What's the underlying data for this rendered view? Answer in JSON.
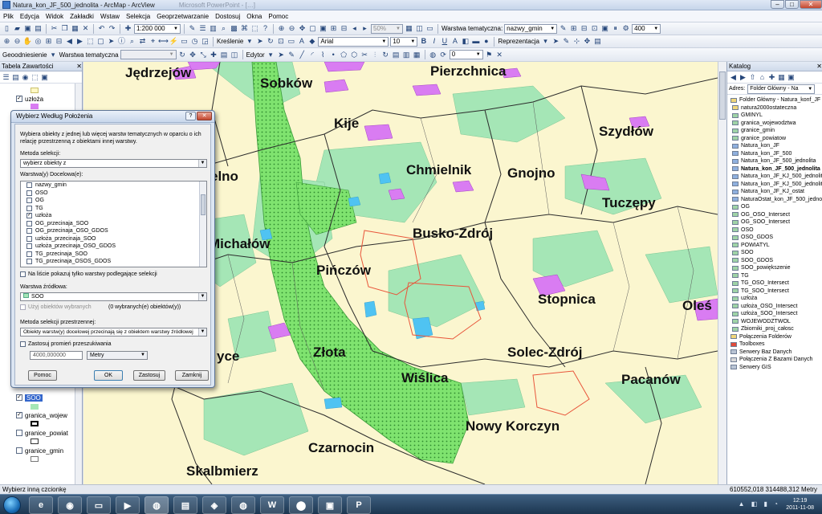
{
  "window": {
    "title": "Natura_kon_JF_500_jednolita - ArcMap - ArcView",
    "ghost_title": "Microsoft PowerPoint - […]"
  },
  "menu": [
    "Plik",
    "Edycja",
    "Widok",
    "Zakładki",
    "Wstaw",
    "Selekcja",
    "Geoprzetwarzanie",
    "Dostosuj",
    "Okna",
    "Pomoc"
  ],
  "toolbar": {
    "scale": "1:200 000",
    "zoom_percent": "50%",
    "thematic_layer_label": "Warstwa tematyczna:",
    "thematic_layer_value": "nazwy_gmin",
    "scale_value2": "400",
    "drawing_label": "Kreślenie",
    "font_name": "Arial",
    "font_size": "10",
    "representation_label": "Reprezentacja",
    "georef_label": "Geoodniesienie",
    "georef_layer_label": "Warstwa tematyczna",
    "editor_label": "Edytor",
    "angle_value": "0"
  },
  "toc": {
    "title": "Tabela Zawartości",
    "items": [
      {
        "label": "uzłoża",
        "checked": true
      },
      {
        "label": "SOO",
        "checked": true
      },
      {
        "label": "granica_wojew",
        "checked": true
      },
      {
        "label": "granice_powiat",
        "checked": false
      },
      {
        "label": "granice_gmin",
        "checked": false
      }
    ]
  },
  "map": {
    "towns": [
      "Jędrzejów",
      "Sobków",
      "Pierzchnica",
      "Kije",
      "Szydłów",
      "Chmielnik",
      "Gnojno",
      "Tuczępy",
      "elno",
      "Busko-Zdrój",
      "Michałów",
      "Pińczów",
      "Stopnica",
      "Oleś",
      "Złota",
      "Solec-Zdrój",
      "yce",
      "Wiślica",
      "Pacanów",
      "Nowy Korczyn",
      "Czarnocin",
      "Skalbmierz"
    ],
    "colors": {
      "background": "#fbf6cf",
      "forest": "#a5e6b6",
      "natura": "#7fe36f",
      "deposits": "#d97cf2",
      "water": "#4fc3f2",
      "outline": "#e8553a"
    }
  },
  "catalog": {
    "title": "Katalog",
    "address_label": "Adres:",
    "address_value": "Folder Główny - Na",
    "items": [
      {
        "label": "Folder Główny - Natura_konf_JF",
        "icon": "folder-icon",
        "bold": false
      },
      {
        "label": "natura2000ostateczna",
        "icon": "folder-icon",
        "bold": false
      },
      {
        "label": "GMINYL",
        "icon": "layer-icon",
        "bold": false
      },
      {
        "label": "granica_wojewodztwa",
        "icon": "layer-icon",
        "bold": false
      },
      {
        "label": "granice_gmin",
        "icon": "layer-icon",
        "bold": false
      },
      {
        "label": "granice_powiatow",
        "icon": "layer-icon",
        "bold": false
      },
      {
        "label": "Natura_kon_JF",
        "icon": "map-doc-icon",
        "bold": false
      },
      {
        "label": "Natura_kon_JF_500",
        "icon": "map-doc-icon",
        "bold": false
      },
      {
        "label": "Natura_kon_JF_500_jednolita",
        "icon": "map-doc-icon",
        "bold": false
      },
      {
        "label": "Natura_kon_JF_500_jednolita",
        "icon": "map-doc-icon",
        "bold": true
      },
      {
        "label": "Natura_kon_JF_KJ_500_jednolita",
        "icon": "map-doc-icon",
        "bold": false
      },
      {
        "label": "Natura_kon_JF_KJ_500_jednolita",
        "icon": "map-doc-icon",
        "bold": false
      },
      {
        "label": "Natura_kon_JF_KJ_ostat",
        "icon": "map-doc-icon",
        "bold": false
      },
      {
        "label": "NaturaOstat_kon_JF_500_jednolita",
        "icon": "map-doc-icon",
        "bold": false
      },
      {
        "label": "OG",
        "icon": "layer-icon",
        "bold": false
      },
      {
        "label": "OG_OSO_Intersect",
        "icon": "layer-icon",
        "bold": false
      },
      {
        "label": "OG_SOO_Intersect",
        "icon": "layer-icon",
        "bold": false
      },
      {
        "label": "OSO",
        "icon": "layer-icon",
        "bold": false
      },
      {
        "label": "OSO_GDOS",
        "icon": "layer-icon",
        "bold": false
      },
      {
        "label": "POWIATYL",
        "icon": "layer-icon",
        "bold": false
      },
      {
        "label": "SOO",
        "icon": "layer-icon",
        "bold": false
      },
      {
        "label": "SOO_GDOS",
        "icon": "layer-icon",
        "bold": false
      },
      {
        "label": "SOO_powiększenie",
        "icon": "layer-icon",
        "bold": false
      },
      {
        "label": "TG",
        "icon": "layer-icon",
        "bold": false
      },
      {
        "label": "TG_OSO_Intersect",
        "icon": "layer-icon",
        "bold": false
      },
      {
        "label": "TG_SOO_Intersect",
        "icon": "layer-icon",
        "bold": false
      },
      {
        "label": "uzłoża",
        "icon": "layer-icon",
        "bold": false
      },
      {
        "label": "uzłoża_OSO_Intersect",
        "icon": "layer-icon",
        "bold": false
      },
      {
        "label": "uzłoża_SOO_Intersect",
        "icon": "layer-icon",
        "bold": false
      },
      {
        "label": "WOJEWODZTWOL",
        "icon": "layer-icon",
        "bold": false
      },
      {
        "label": "Zbiorniki_proj_całosc",
        "icon": "layer-icon",
        "bold": false
      },
      {
        "label": "Połączenia Folderów",
        "icon": "folder-icon",
        "bold": false
      },
      {
        "label": "Toolboxes",
        "icon": "toolbox-icon",
        "bold": false
      },
      {
        "label": "Serwery Baz Danych",
        "icon": "server-icon",
        "bold": false
      },
      {
        "label": "Połączenia Z Bazami Danych",
        "icon": "database-icon",
        "bold": false
      },
      {
        "label": "Serwery GIS",
        "icon": "server-icon",
        "bold": false
      }
    ]
  },
  "dialog": {
    "title": "Wybierz Według Położenia",
    "description": "Wybiera obiekty z jednej lub więcej warstw tematycznych w oparciu o ich relację przestrzenną z obiektami innej warstwy.",
    "method_label": "Metoda selekcji:",
    "method_value": "wybierz obiekty z",
    "target_label": "Warstwa(y) Docelowa(e):",
    "target_layers": [
      {
        "label": "nazwy_gmin",
        "checked": false
      },
      {
        "label": "OSO",
        "checked": false
      },
      {
        "label": "OG",
        "checked": false
      },
      {
        "label": "TG",
        "checked": false
      },
      {
        "label": "uzłoża",
        "checked": true
      },
      {
        "label": "OG_przecinaja_SOO",
        "checked": false
      },
      {
        "label": "OG_przecinaja_OSO_GDOS",
        "checked": false
      },
      {
        "label": "uzłoża_przecinaja_SOO",
        "checked": false
      },
      {
        "label": "uzłoża_przecinaja_OSO_GDOS",
        "checked": false
      },
      {
        "label": "TG_przecinaja_SOO",
        "checked": false
      },
      {
        "label": "TG_przecinaja_OSOS_GDOS",
        "checked": false
      }
    ],
    "only_selectable_label": "Na liście pokazuj tylko warstwy podlegające selekcji",
    "source_label": "Warstwa źródłowa:",
    "source_value": "SOO",
    "use_selected_label": "Użyj obiektów wybranych",
    "selected_count": "(0 wybranych(e) obiektów(y))",
    "spatial_method_label": "Metoda selekcji przestrzennej:",
    "spatial_method_value": "Obiekty warstw(y) docelowej przecinają się z obiektem warstwy źródłowej",
    "buffer_label": "Zastosuj promień przeszukiwania",
    "buffer_value": "4000,000000",
    "buffer_unit": "Metry",
    "buttons": {
      "help": "Pomoc",
      "ok": "OK",
      "apply": "Zastosuj",
      "close": "Zamknij"
    }
  },
  "status": {
    "hint": "Wybierz inną czcionkę",
    "coords": "610552,018  314488,312 Metry"
  },
  "taskbar": {
    "time": "12:19",
    "date": "2011-11-08"
  }
}
